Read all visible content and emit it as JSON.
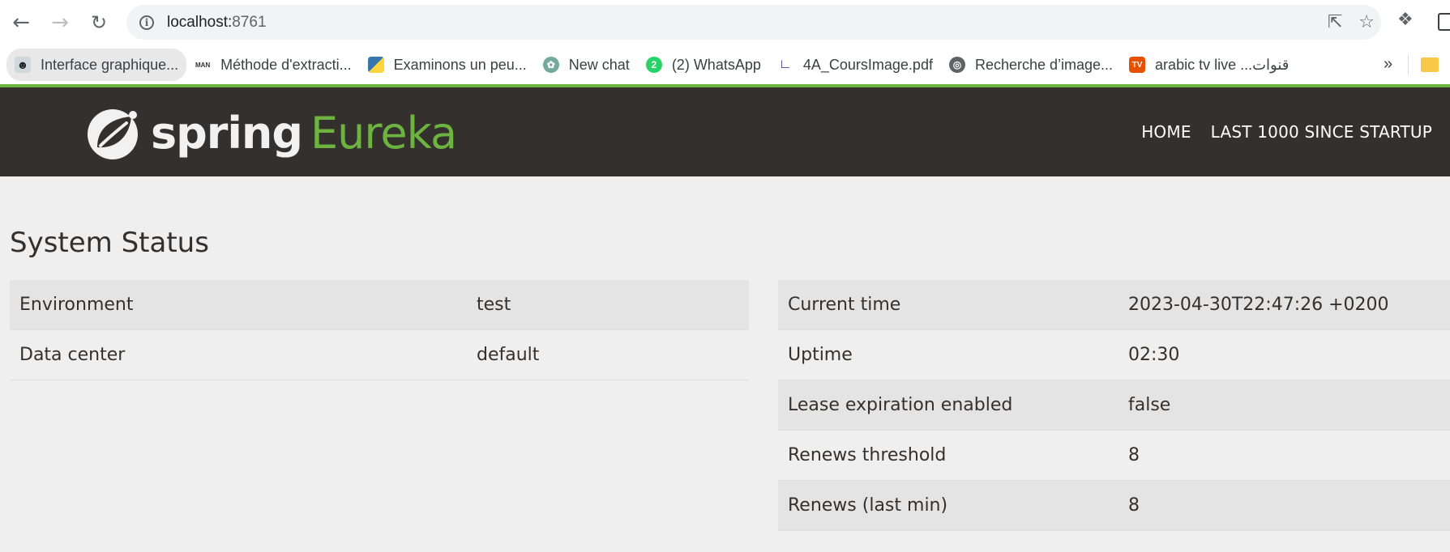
{
  "browser": {
    "url_host": "localhost:",
    "url_port": "8761",
    "bookmarks": [
      {
        "label": "Interface graphique...",
        "icon": "avatar-sunglasses-icon"
      },
      {
        "label": "Méthode d'extracti...",
        "icon": "man-page-icon",
        "fav_text": "MAN"
      },
      {
        "label": "Examinons un peu...",
        "icon": "python-icon"
      },
      {
        "label": "New chat",
        "icon": "chatgpt-icon"
      },
      {
        "label": "(2) WhatsApp",
        "icon": "whatsapp-icon",
        "fav_text": "2"
      },
      {
        "label": "4A_CoursImage.pdf",
        "icon": "pdf-icon"
      },
      {
        "label": "Recherche d’image...",
        "icon": "globe-icon"
      },
      {
        "label": "arabic tv live ...قنوات",
        "icon": "tv-icon",
        "fav_text": "TV"
      }
    ],
    "more_label": "»"
  },
  "header": {
    "brand_spring": "spring",
    "brand_eureka": "Eureka",
    "nav": [
      "HOME",
      "LAST 1000 SINCE STARTUP"
    ]
  },
  "main": {
    "title": "System Status",
    "left_rows": [
      {
        "key": "Environment",
        "value": "test"
      },
      {
        "key": "Data center",
        "value": "default"
      }
    ],
    "right_rows": [
      {
        "key": "Current time",
        "value": "2023-04-30T22:47:26 +0200"
      },
      {
        "key": "Uptime",
        "value": "02:30"
      },
      {
        "key": "Lease expiration enabled",
        "value": "false"
      },
      {
        "key": "Renews threshold",
        "value": "8"
      },
      {
        "key": "Renews (last min)",
        "value": "8"
      }
    ]
  },
  "colors": {
    "header_bg": "#34302d",
    "spring_green": "#6db33f",
    "page_bg": "#efefef"
  }
}
